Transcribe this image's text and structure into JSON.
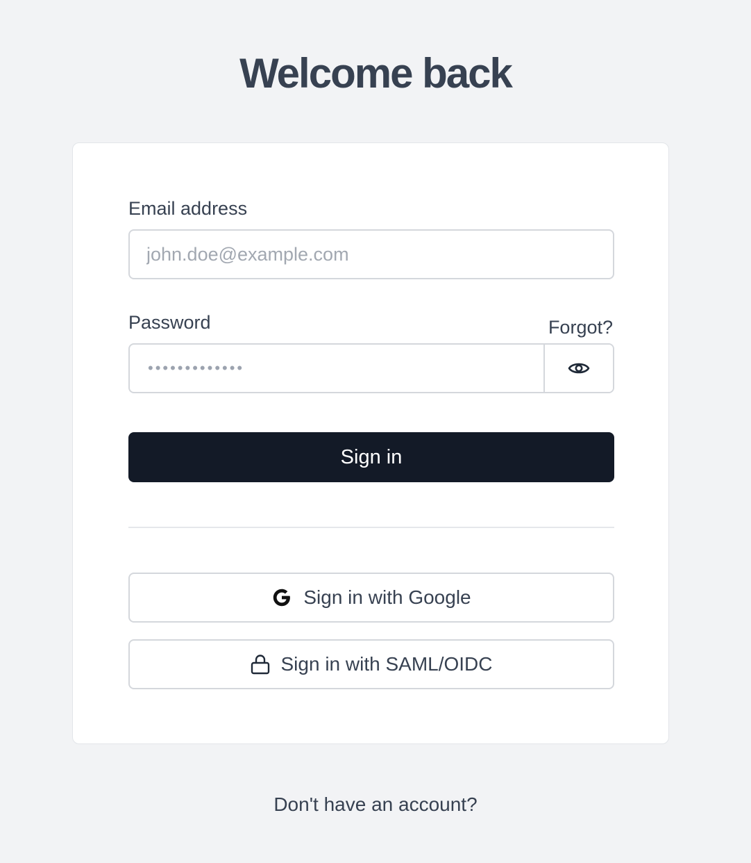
{
  "page": {
    "title": "Welcome back"
  },
  "form": {
    "email": {
      "label": "Email address",
      "placeholder": "john.doe@example.com",
      "value": ""
    },
    "password": {
      "label": "Password",
      "masked_value": "•••••••••••••",
      "forgot_label": "Forgot?",
      "toggle_icon": "eye-icon"
    },
    "submit_label": "Sign in"
  },
  "sso": {
    "google_label": "Sign in with Google",
    "google_icon": "google-icon",
    "saml_label": "Sign in with SAML/OIDC",
    "saml_icon": "lock-icon"
  },
  "footer": {
    "signup_prompt": "Don't have an account?"
  },
  "colors": {
    "background": "#f2f3f5",
    "card": "#ffffff",
    "primary_button": "#131a27",
    "text": "#374151",
    "border": "#d4d7dc",
    "placeholder": "#a2a8b1"
  }
}
